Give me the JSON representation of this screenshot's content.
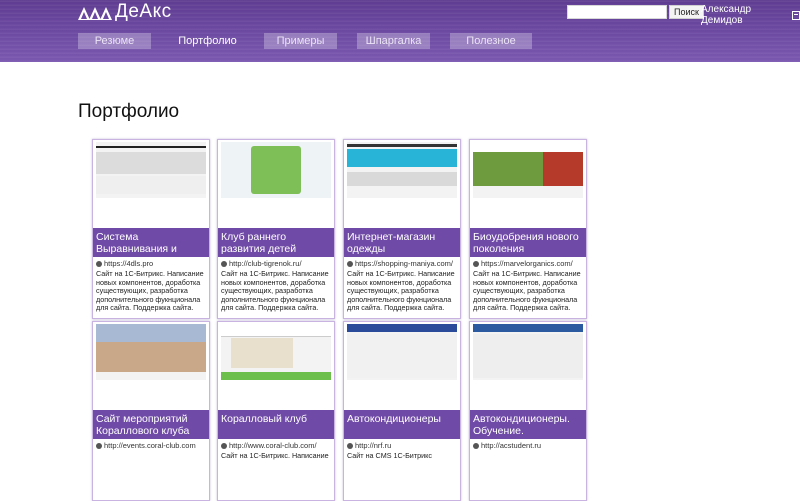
{
  "header": {
    "logo_text": "ДеАкс",
    "search_placeholder": "",
    "search_button": "Поиск",
    "user_name": "Александр Демидов",
    "nav": [
      "Резюме",
      "Портфолио",
      "Примеры",
      "Шпаргалка",
      "Полезное"
    ],
    "active_nav": "Портфолио"
  },
  "page": {
    "title": "Портфолио"
  },
  "portfolio": [
    {
      "title": "Система Выравнивания и Укладки Плитки",
      "url": "https://4dls.pro",
      "desc": "Сайт на 1С-Битрикс. Написание новых компонентов, доработка существующих, разработка дополнительного фукнционала для сайта. Поддержка сайта."
    },
    {
      "title": "Клуб раннего развития детей",
      "url": "http://club-tigrenok.ru/",
      "desc": "Сайт на 1С-Битрикс. Написание новых компонентов, доработка существующих, разработка дополнительного фукнционала для сайта. Поддержка сайта."
    },
    {
      "title": "Интернет-магазин одежды",
      "url": "https://shopping-maniya.com/",
      "desc": "Сайт на 1С-Битрикс. Написание новых компонентов, доработка существующих, разработка дополнительного фукнционала для сайта. Поддержка сайта."
    },
    {
      "title": "Биоудобрения нового поколения",
      "url": "https://marvelorganics.com/",
      "desc": "Сайт на 1С-Битрикс. Написание новых компонентов, доработка существующих, разработка дополнительного фукнционала для сайта. Поддержка сайта."
    },
    {
      "title": "Сайт мероприятий Кораллового клуба",
      "url": "http://events.coral-club.com",
      "desc": ""
    },
    {
      "title": "Коралловый клуб",
      "url": "http://www.coral-club.com/",
      "desc": "Сайт на 1С-Битрикс. Написание"
    },
    {
      "title": "Автокондиционеры",
      "url": "http://nrf.ru",
      "desc": "Сайт на CMS 1С-Битрикс"
    },
    {
      "title": "Автокондиционеры. Обучение.",
      "url": "http://acstudent.ru",
      "desc": ""
    }
  ],
  "colors": {
    "brand_purple": "#6f4aa6",
    "header_purple": "#6b48a0"
  }
}
